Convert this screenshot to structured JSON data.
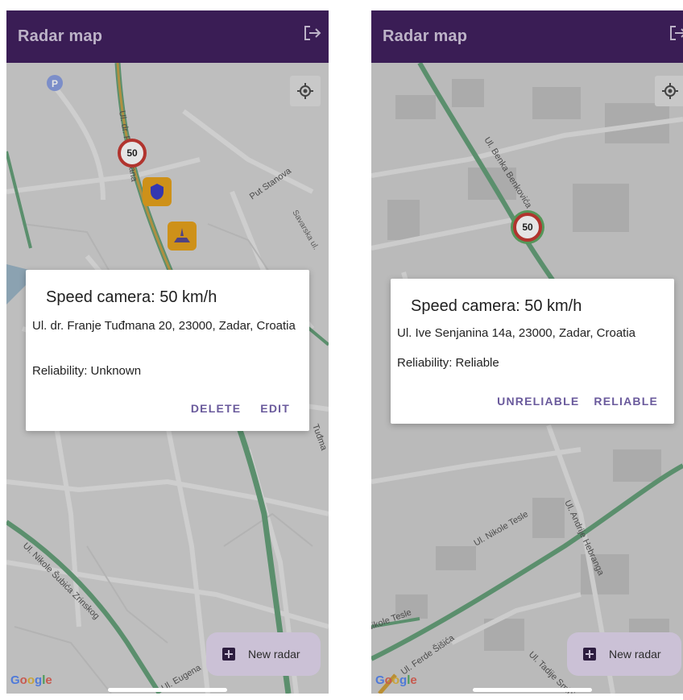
{
  "screens": [
    {
      "app_title": "Radar map",
      "dialog": {
        "title": "Speed camera: 50 km/h",
        "address": "Ul. dr. Franje Tuđmana 20, 23000, Zadar, Croatia",
        "reliability": "Reliability: Unknown",
        "actions": [
          "DELETE",
          "EDIT"
        ]
      },
      "fab_label": "New radar",
      "markers": [
        "50"
      ],
      "streets": [
        "Ul. dr. F. Tuđmana",
        "Put Stanova",
        "Savarska ul.",
        "Ul. Nikole Šubića Zrinskog",
        "Ul. Eugena",
        "Tuđma"
      ],
      "map_attribution": "Google"
    },
    {
      "app_title": "Radar map",
      "dialog": {
        "title": "Speed camera: 50 km/h",
        "address": "Ul. Ive Senjanina 14a, 23000, Zadar, Croatia",
        "reliability": "Reliability: Reliable",
        "actions": [
          "UNRELIABLE",
          "RELIABLE"
        ]
      },
      "fab_label": "New radar",
      "markers": [
        "50"
      ],
      "streets": [
        "Ul. Benka Benkovića",
        "Ul. Nikole Tesle",
        "Ul. Andrije Hebranga",
        "Ul. Ferde Šišića",
        "Ul. Tadije Smičiklasa"
      ],
      "map_attribution": "Google"
    }
  ]
}
